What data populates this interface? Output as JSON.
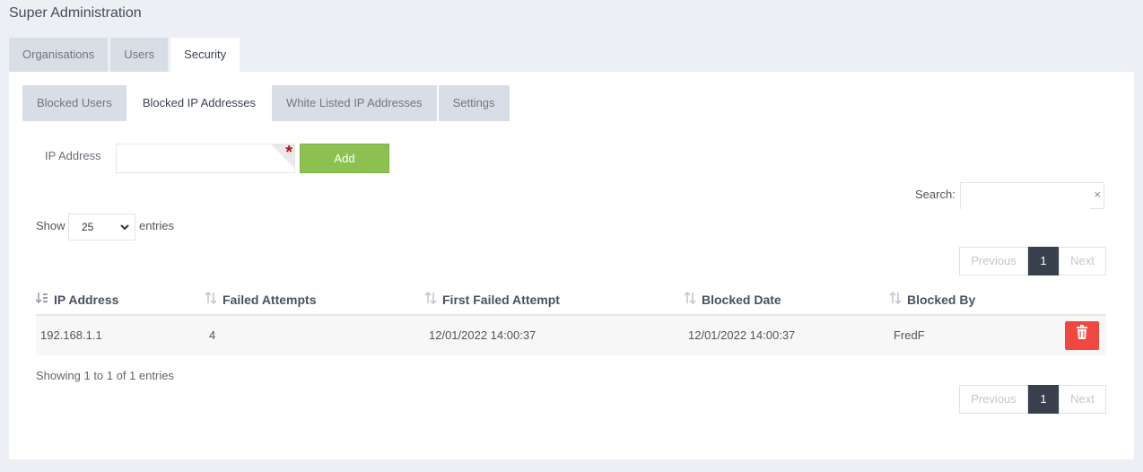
{
  "page": {
    "title": "Super Administration"
  },
  "main_tabs": [
    {
      "label": "Organisations",
      "active": false
    },
    {
      "label": "Users",
      "active": false
    },
    {
      "label": "Security",
      "active": true
    }
  ],
  "security_tabs": [
    {
      "label": "Blocked Users",
      "active": false
    },
    {
      "label": "Blocked IP Addresses",
      "active": true
    },
    {
      "label": "White Listed IP Addresses",
      "active": false
    },
    {
      "label": "Settings",
      "active": false
    }
  ],
  "form": {
    "ip_label": "IP Address",
    "ip_value": "",
    "required_mark": "*",
    "add_label": "Add"
  },
  "search": {
    "label": "Search:",
    "value": "",
    "clear_icon": "×"
  },
  "length": {
    "show_label": "Show",
    "selected": "25",
    "entries_label": "entries"
  },
  "pagination": {
    "previous": "Previous",
    "current": "1",
    "next": "Next"
  },
  "table": {
    "columns": [
      "IP Address",
      "Failed Attempts",
      "First Failed Attempt",
      "Blocked Date",
      "Blocked By"
    ],
    "rows": [
      {
        "ip": "192.168.1.1",
        "attempts": "4",
        "first_failed": "12/01/2022 14:00:37",
        "blocked_date": "12/01/2022 14:00:37",
        "blocked_by": "FredF"
      }
    ]
  },
  "info": {
    "showing": "Showing 1 to 1 of 1 entries"
  },
  "colors": {
    "add": "#8cc152",
    "delete": "#f0483e",
    "page_active": "#37404c",
    "required": "#b8151b"
  }
}
